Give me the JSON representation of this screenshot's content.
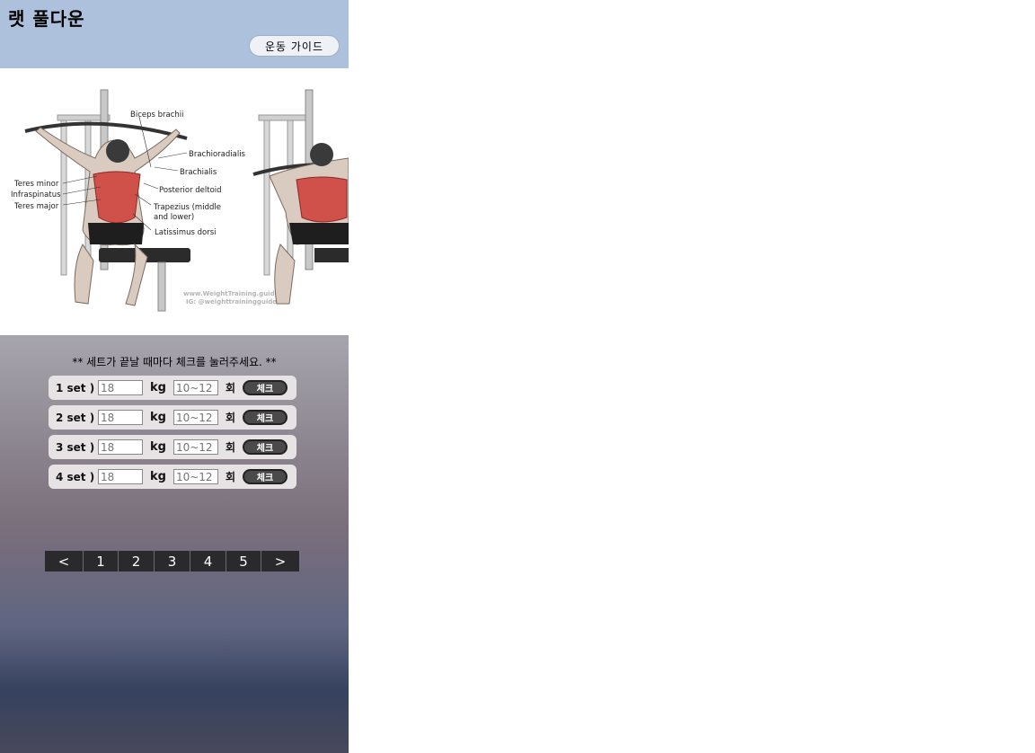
{
  "header": {
    "title": "랫 풀다운",
    "guide_button": "운동 가이드"
  },
  "illustration": {
    "labels": [
      "Biceps brachii",
      "Brachioradialis",
      "Brachialis",
      "Posterior deltoid",
      "Teres minor",
      "Infraspinatus",
      "Teres major",
      "Trapezius (middle",
      "and lower)",
      "Latissimus dorsi"
    ],
    "watermark": [
      "www.WeightTraining.guide",
      "IG: @weighttrainingguide"
    ]
  },
  "workout": {
    "notice": "** 세트가 끝날 때마다 체크를 눌러주세요. **",
    "sets": [
      {
        "label": "1 set )",
        "weight_placeholder": "18",
        "reps_placeholder": "10~12",
        "weight_unit": "kg",
        "reps_unit": "회",
        "check": "체크"
      },
      {
        "label": "2 set )",
        "weight_placeholder": "18",
        "reps_placeholder": "10~12",
        "weight_unit": "kg",
        "reps_unit": "회",
        "check": "체크"
      },
      {
        "label": "3 set )",
        "weight_placeholder": "18",
        "reps_placeholder": "10~12",
        "weight_unit": "kg",
        "reps_unit": "회",
        "check": "체크"
      },
      {
        "label": "4 set )",
        "weight_placeholder": "18",
        "reps_placeholder": "10~12",
        "weight_unit": "kg",
        "reps_unit": "회",
        "check": "체크"
      }
    ]
  },
  "pagination": {
    "prev": "<",
    "pages": [
      "1",
      "2",
      "3",
      "4",
      "5"
    ],
    "next": ">"
  }
}
